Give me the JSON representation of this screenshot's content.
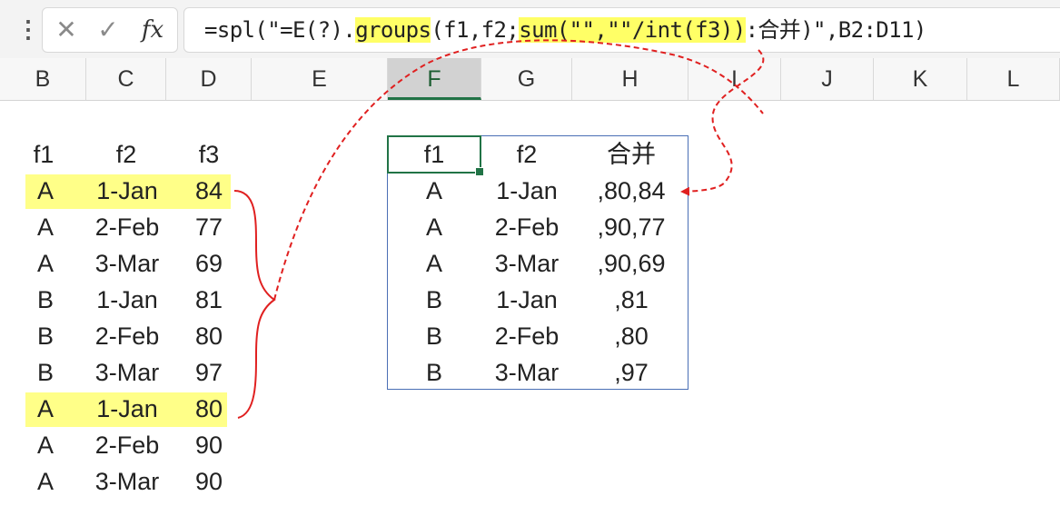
{
  "formula_bar": {
    "menu_dots": "⋮",
    "cancel_icon": "✕",
    "confirm_icon": "✓",
    "fx_label": "fx",
    "formula": {
      "part1": "=spl(\"=E(?).",
      "part2": "groups",
      "part3": "(f1,f2;",
      "part4": "sum(\"\",\"\"/int(f3))",
      "part5": ":合并)\",B2:D11)"
    }
  },
  "columns": [
    "B",
    "C",
    "D",
    "E",
    "F",
    "G",
    "H",
    "I",
    "J",
    "K",
    "L"
  ],
  "selected_column": "F",
  "source_table": {
    "headers": [
      "f1",
      "f2",
      "f3"
    ],
    "rows": [
      [
        "A",
        "1-Jan",
        "84"
      ],
      [
        "A",
        "2-Feb",
        "77"
      ],
      [
        "A",
        "3-Mar",
        "69"
      ],
      [
        "B",
        "1-Jan",
        "81"
      ],
      [
        "B",
        "2-Feb",
        "80"
      ],
      [
        "B",
        "3-Mar",
        "97"
      ],
      [
        "A",
        "1-Jan",
        "80"
      ],
      [
        "A",
        "2-Feb",
        "90"
      ],
      [
        "A",
        "3-Mar",
        "90"
      ]
    ]
  },
  "result_table": {
    "headers": [
      "f1",
      "f2",
      "合并"
    ],
    "rows": [
      [
        "A",
        "1-Jan",
        ",80,84"
      ],
      [
        "A",
        "2-Feb",
        ",90,77"
      ],
      [
        "A",
        "3-Mar",
        ",90,69"
      ],
      [
        "B",
        "1-Jan",
        ",81"
      ],
      [
        "B",
        "2-Feb",
        ",80"
      ],
      [
        "B",
        "3-Mar",
        ",97"
      ]
    ]
  },
  "colors": {
    "highlight": "#ffff66",
    "annotation": "#e02020",
    "selection": "#217346",
    "result_border": "#4a6fb5"
  }
}
